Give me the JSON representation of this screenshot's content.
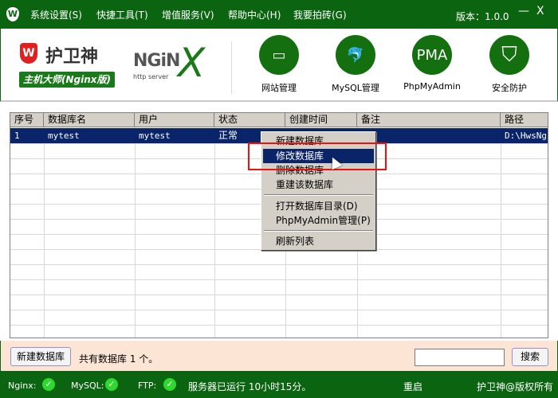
{
  "titlebar": {
    "menus": [
      "系统设置(S)",
      "快捷工具(T)",
      "增值服务(V)",
      "帮助中心(H)",
      "我要拍砖(G)"
    ],
    "version": "版本：1.0.0",
    "minimize": "—",
    "close": "X"
  },
  "brand": {
    "logo_letter": "W",
    "name": "护卫神",
    "subtitle": "主机大师(Nginx版)",
    "nginx": "NGiN",
    "nginx_x": "X",
    "nginx_sub": "http server"
  },
  "tools": [
    {
      "label": "网站管理",
      "icon": "monitor-icon",
      "glyph": "▭"
    },
    {
      "label": "MySQL管理",
      "icon": "dolphin-icon",
      "glyph": "🐬"
    },
    {
      "label": "PhpMyAdmin",
      "icon": "pma-icon",
      "glyph": "PMA"
    },
    {
      "label": "安全防护",
      "icon": "shield-icon",
      "glyph": "⛉"
    }
  ],
  "table": {
    "columns": [
      "序号",
      "数据库名",
      "用户",
      "状态",
      "创建时间",
      "备注",
      "路径"
    ],
    "rows": [
      [
        "1",
        "mytest",
        "mytest",
        "正常",
        "",
        "",
        "D:\\HwsNginx"
      ]
    ]
  },
  "context_menu": {
    "items": [
      "新建数据库",
      "修改数据库",
      "删除数据库",
      "重建该数据库",
      "打开数据库目录(D)",
      "PhpMyAdmin管理(P)",
      "刷新列表"
    ],
    "active": "修改数据库"
  },
  "bottom": {
    "new_db": "新建数据库",
    "count_text": "共有数据库 1 个。",
    "search_value": "",
    "search_button": "搜索"
  },
  "status": {
    "nginx": "Nginx:",
    "mysql": "MySQL:",
    "ftp": "FTP:",
    "uptime": "服务器已运行 10小时15分。",
    "restart": "重启",
    "copyright": "护卫神@版权所有",
    "check": "✓"
  },
  "colors": {
    "brand_green": "#0b6410",
    "selection": "#0a246a",
    "highlight_box": "#f01010"
  }
}
